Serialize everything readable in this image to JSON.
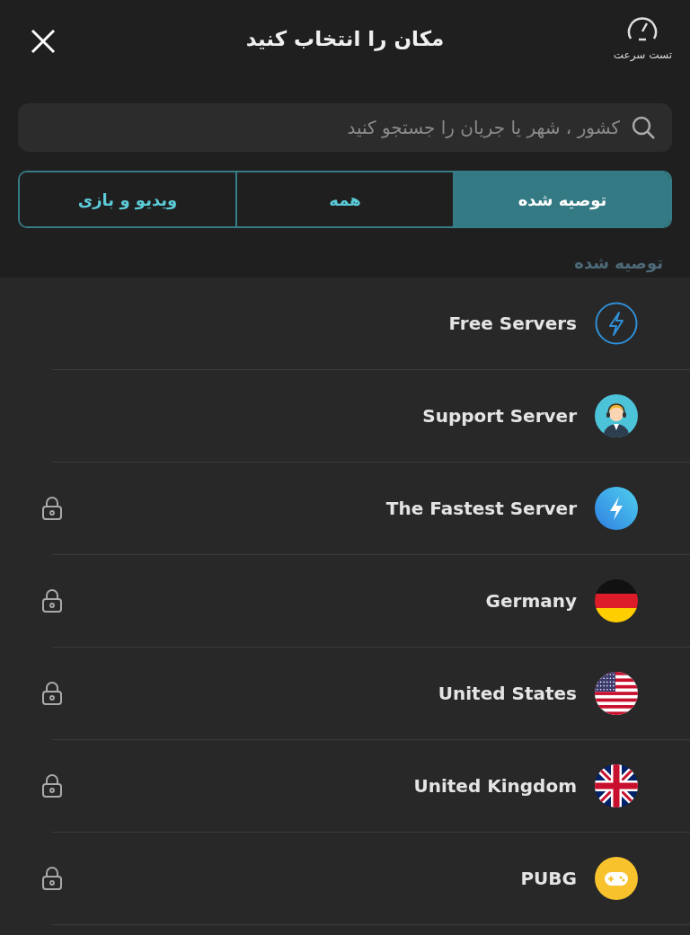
{
  "header": {
    "title": "مکان را انتخاب کنید",
    "speed_test": {
      "label": "تست سرعت"
    }
  },
  "search": {
    "placeholder": "کشور ، شهر یا جریان را جستجو کنید"
  },
  "tabs": [
    {
      "label": "توصیه شده",
      "selected": true
    },
    {
      "label": "همه",
      "selected": false
    },
    {
      "label": "ویدیو و بازی",
      "selected": false
    }
  ],
  "section_title": "توصیه شده",
  "servers": [
    {
      "name": "Free Servers",
      "kind": "bolt-outline",
      "locked": false
    },
    {
      "name": "Support Server",
      "kind": "support",
      "locked": false
    },
    {
      "name": "The Fastest Server",
      "kind": "bolt",
      "locked": true
    },
    {
      "name": "Germany",
      "kind": "flag-de",
      "locked": true
    },
    {
      "name": "United States",
      "kind": "flag-us",
      "locked": true
    },
    {
      "name": "United Kingdom",
      "kind": "flag-uk",
      "locked": true
    },
    {
      "name": "PUBG",
      "kind": "gamepad",
      "locked": true
    }
  ]
}
